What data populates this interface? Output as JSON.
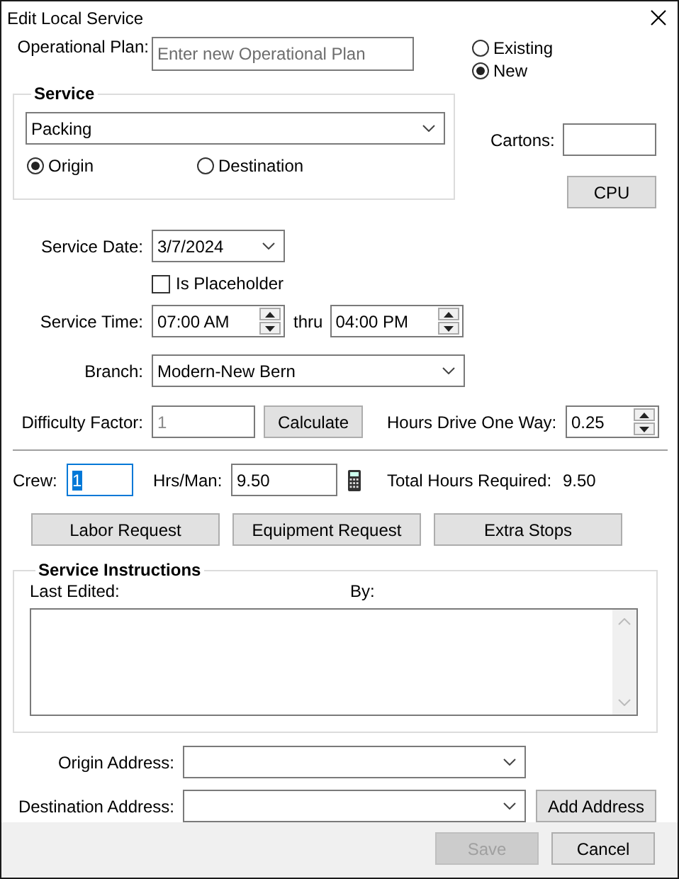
{
  "window": {
    "title": "Edit Local Service"
  },
  "operational_plan": {
    "label": "Operational Plan:",
    "placeholder": "Enter new Operational Plan"
  },
  "plan_mode": [
    {
      "label": "Existing",
      "selected": false
    },
    {
      "label": "New",
      "selected": true
    }
  ],
  "service": {
    "title": "Service",
    "value": "Packing",
    "direction": [
      {
        "label": "Origin",
        "selected": true
      },
      {
        "label": "Destination",
        "selected": false
      }
    ]
  },
  "cartons": {
    "label": "Cartons:"
  },
  "cpu_button": "CPU",
  "service_date": {
    "label": "Service Date:",
    "value": "3/7/2024"
  },
  "is_placeholder": {
    "label": "Is Placeholder",
    "checked": false
  },
  "service_time": {
    "label": "Service Time:",
    "from": "07:00 AM",
    "separator": "thru",
    "to": "04:00 PM"
  },
  "branch": {
    "label": "Branch:",
    "value": "Modern-New Bern"
  },
  "difficulty_factor": {
    "label": "Difficulty Factor:",
    "value": "1",
    "disabled": true
  },
  "calculate_button": "Calculate",
  "hours_drive": {
    "label": "Hours Drive One Way:",
    "value": "0.25"
  },
  "crew": {
    "label": "Crew:",
    "value": "1",
    "focused": true
  },
  "hrs_per_man": {
    "label": "Hrs/Man:",
    "value": "9.50"
  },
  "total_hours": {
    "label": "Total Hours Required:",
    "value": "9.50"
  },
  "action_buttons": [
    "Labor Request",
    "Equipment Request",
    "Extra Stops"
  ],
  "service_instructions": {
    "title": "Service Instructions",
    "last_edited_label": "Last Edited:",
    "by_label": "By:"
  },
  "origin_address": {
    "label": "Origin Address:"
  },
  "destination_address": {
    "label": "Destination Address:"
  },
  "add_address_button": "Add Address",
  "footer_buttons": [
    {
      "label": "Save",
      "disabled": true
    },
    {
      "label": "Cancel",
      "disabled": false
    }
  ]
}
